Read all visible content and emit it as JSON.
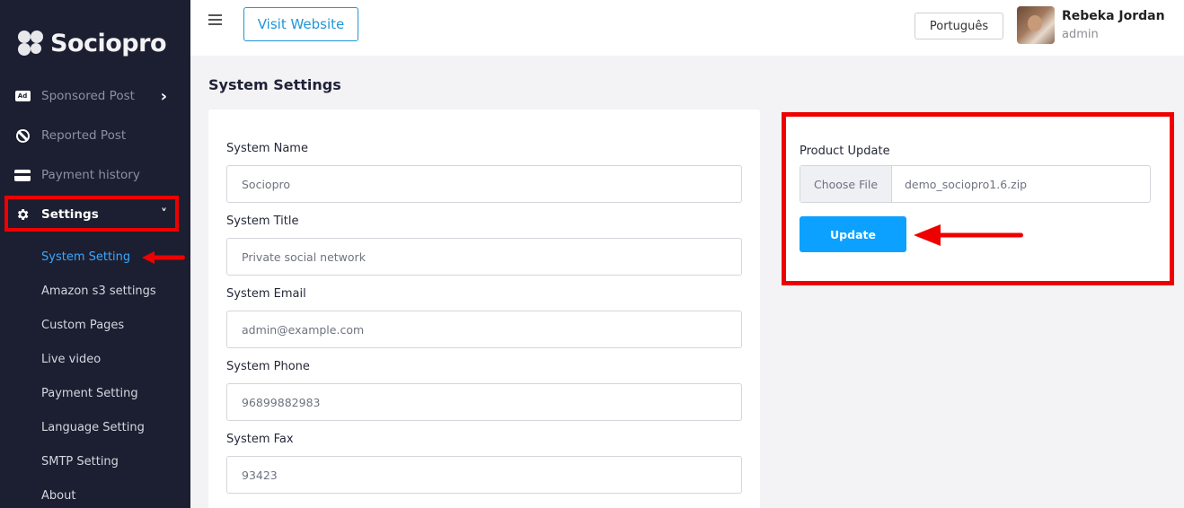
{
  "sidebar": {
    "logo_text": "Sociopro",
    "nav": [
      {
        "label": "Sponsored Post",
        "icon": "ad-icon",
        "has_chevron": true
      },
      {
        "label": "Reported Post",
        "icon": "ban-icon"
      },
      {
        "label": "Payment history",
        "icon": "credit-card-icon"
      },
      {
        "label": "Settings",
        "icon": "gear-icon",
        "expanded": true
      }
    ],
    "settings_sub": [
      "System Setting",
      "Amazon s3 settings",
      "Custom Pages",
      "Live video",
      "Payment Setting",
      "Language Setting",
      "SMTP Setting",
      "About"
    ],
    "selected_sub": "System Setting",
    "chevron_right": "›",
    "chevron_down": "˅"
  },
  "topbar": {
    "visit_website": "Visit Website",
    "language": "Português",
    "user_name": "Rebeka Jordan",
    "user_role": "admin"
  },
  "main": {
    "page_title": "System Settings",
    "fields": [
      {
        "label": "System Name",
        "value": "Sociopro"
      },
      {
        "label": "System Title",
        "value": "Private social network"
      },
      {
        "label": "System Email",
        "value": "admin@example.com"
      },
      {
        "label": "System Phone",
        "value": "96899882983"
      },
      {
        "label": "System Fax",
        "value": "93423"
      }
    ]
  },
  "product_update": {
    "label": "Product Update",
    "choose_file": "Choose File",
    "file_name": "demo_sociopro1.6.zip",
    "update_button": "Update"
  },
  "colors": {
    "sidebar_bg": "#1c1f31",
    "accent_blue": "#0da1ff",
    "highlight_red": "#ef0000",
    "selected_link": "#3aa7ff"
  }
}
